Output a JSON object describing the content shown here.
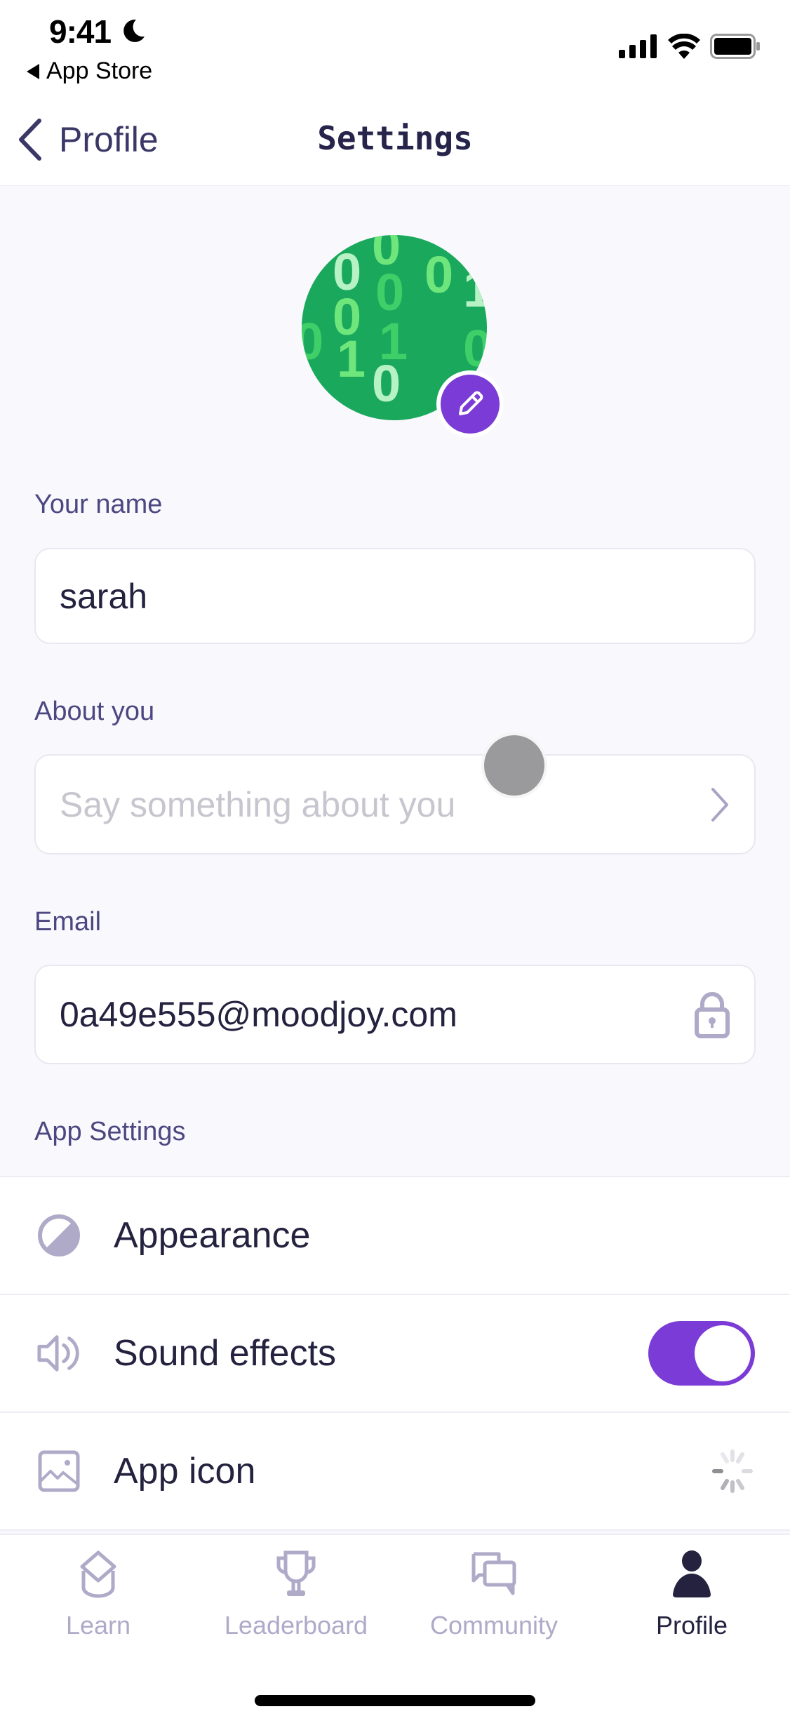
{
  "status_bar": {
    "time": "9:41",
    "back_app": "App Store",
    "icons": [
      "moon-icon",
      "signal-icon",
      "wifi-icon",
      "battery-icon"
    ]
  },
  "nav": {
    "back_label": "Profile",
    "title": "Settings"
  },
  "avatar": {
    "background_color": "#1aa85c",
    "edit_icon": "pencil-icon",
    "accent_color": "#7b3bd6"
  },
  "form": {
    "name": {
      "label": "Your name",
      "value": "sarah"
    },
    "about": {
      "label": "About you",
      "placeholder": "Say something about you",
      "value": ""
    },
    "email": {
      "label": "Email",
      "value": "0a49e555@moodjoy.com",
      "locked": true
    }
  },
  "app_settings": {
    "title": "App Settings",
    "items": [
      {
        "icon": "half-circle-icon",
        "label": "Appearance"
      },
      {
        "icon": "speaker-icon",
        "label": "Sound effects",
        "toggle": true
      },
      {
        "icon": "image-icon",
        "label": "App icon",
        "loading": true
      }
    ]
  },
  "tabbar": {
    "tabs": [
      {
        "icon": "graduation-cap-icon",
        "label": "Learn",
        "active": false
      },
      {
        "icon": "trophy-icon",
        "label": "Leaderboard",
        "active": false
      },
      {
        "icon": "chat-bubbles-icon",
        "label": "Community",
        "active": false
      },
      {
        "icon": "person-icon",
        "label": "Profile",
        "active": true
      }
    ]
  },
  "colors": {
    "accent": "#7b3bd6",
    "text_primary": "#24223f",
    "label": "#4c4780",
    "icon_muted": "#aeaac8",
    "background": "#f8f8fd"
  }
}
